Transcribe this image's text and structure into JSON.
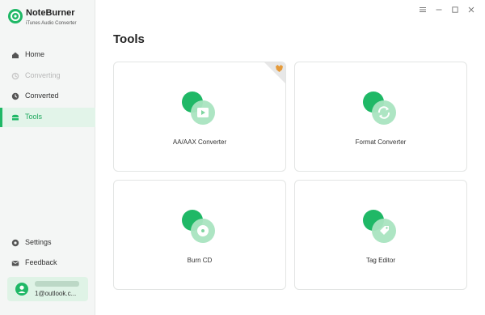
{
  "app": {
    "name": "NoteBurner",
    "subtitle": "iTunes Audio Converter"
  },
  "window_controls": {
    "menu_icon": "menu-icon",
    "minimize_icon": "minimize-icon",
    "maximize_icon": "maximize-icon",
    "close_icon": "close-icon"
  },
  "sidebar": {
    "items": [
      {
        "label": "Home",
        "icon": "home-icon"
      },
      {
        "label": "Converting",
        "icon": "converting-icon",
        "disabled": true
      },
      {
        "label": "Converted",
        "icon": "clock-icon"
      },
      {
        "label": "Tools",
        "icon": "toolbox-icon",
        "active": true
      }
    ],
    "bottom_items": [
      {
        "label": "Settings",
        "icon": "gear-icon"
      },
      {
        "label": "Feedback",
        "icon": "mail-icon"
      }
    ],
    "account": {
      "email": "1@outlook.c..."
    }
  },
  "main": {
    "title": "Tools",
    "tools": [
      {
        "label": "AA/AAX Converter",
        "icon": "video-play-icon"
      },
      {
        "label": "Format Converter",
        "icon": "refresh-icon"
      },
      {
        "label": "Burn CD",
        "icon": "disc-icon"
      },
      {
        "label": "Tag Editor",
        "icon": "tag-icon"
      }
    ]
  },
  "colors": {
    "accent": "#1fb866",
    "accent_light": "#a9e4c0",
    "sidebar_bg": "#f4f6f5"
  }
}
